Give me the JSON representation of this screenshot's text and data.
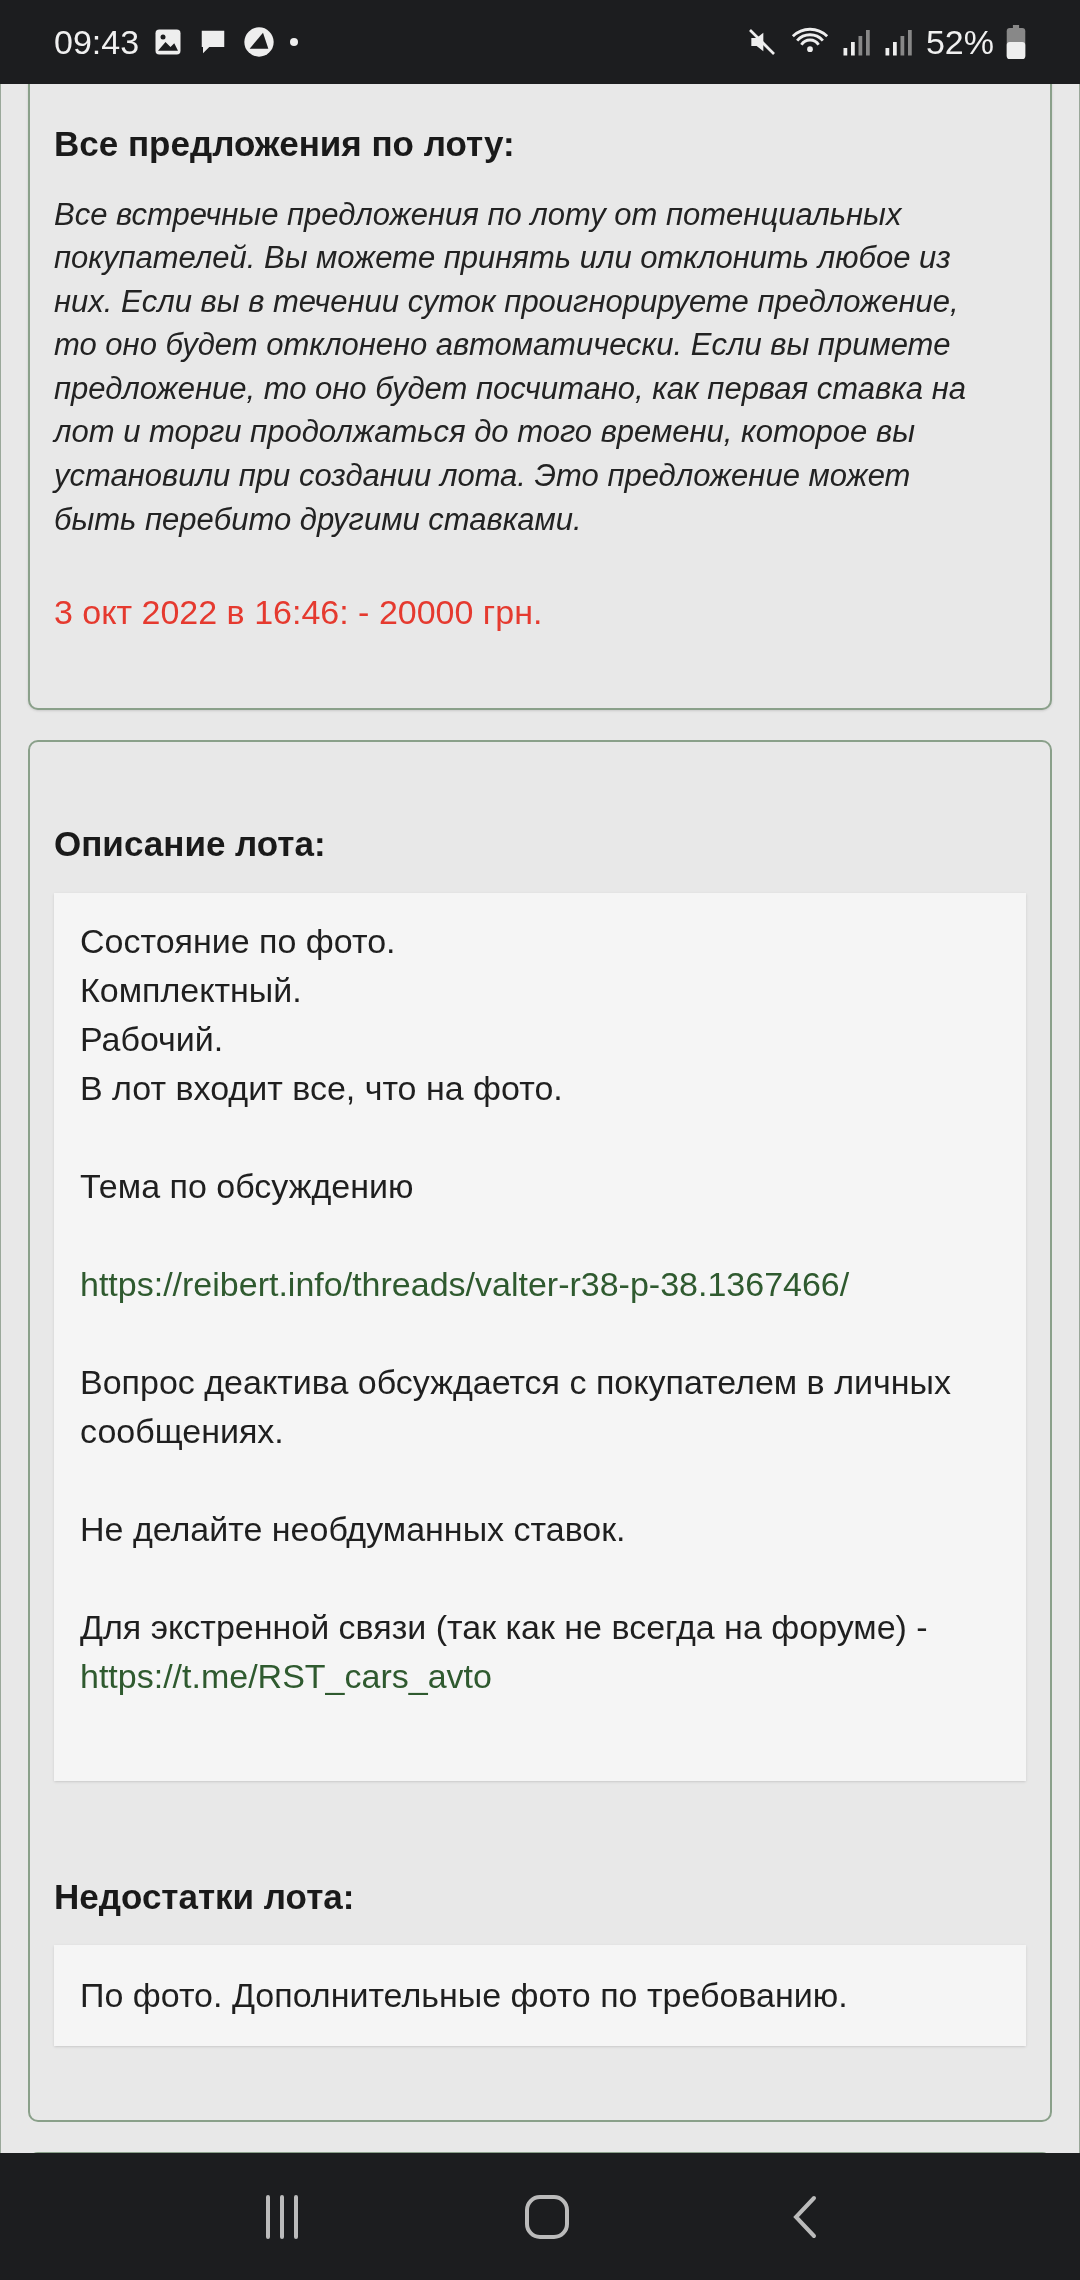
{
  "status_bar": {
    "time": "09:43",
    "battery": "52%"
  },
  "offers": {
    "title": "Все предложения по лоту:",
    "description": "Все встречные предложения по лоту от потенциальных покупателей. Вы можете принять или отклонить любое из них. Если вы в течении суток проигнорируете предложение, то оно будет отклонено автоматически. Если вы примете предложение, то оно будет посчитано, как первая ставка на лот и торги продолжаться до того времени, которое вы установили при создании лота. Это предложение может быть перебито другими ставками.",
    "items": [
      "3 окт 2022 в 16:46: - 20000 грн."
    ]
  },
  "description": {
    "title": "Описание лота:",
    "paragraphs": [
      [
        {
          "kind": "text",
          "text": "Состояние по фото."
        },
        {
          "kind": "break"
        },
        {
          "kind": "text",
          "text": "Комплектный."
        },
        {
          "kind": "break"
        },
        {
          "kind": "text",
          "text": "Рабочий."
        },
        {
          "kind": "break"
        },
        {
          "kind": "text",
          "text": "В лот входит все, что на фото."
        }
      ],
      [
        {
          "kind": "text",
          "text": "Тема по обсуждению"
        }
      ],
      [
        {
          "kind": "link",
          "text": "https://reibert.info/threads/valter-r38-p-38.1367466/"
        }
      ],
      [
        {
          "kind": "text",
          "text": "Вопрос деактива обсуждается с покупателем в личных сообщениях."
        }
      ],
      [
        {
          "kind": "text",
          "text": "Не делайте необдуманных ставок."
        }
      ],
      [
        {
          "kind": "text",
          "text": "Для экстренной связи (так как не всегда на форуме) -"
        },
        {
          "kind": "link",
          "text": "https://t.me/RST_cars_avto"
        }
      ]
    ]
  },
  "defects": {
    "title": "Недостатки лота:",
    "text": "По фото. Дополнительные фото по требованию."
  }
}
